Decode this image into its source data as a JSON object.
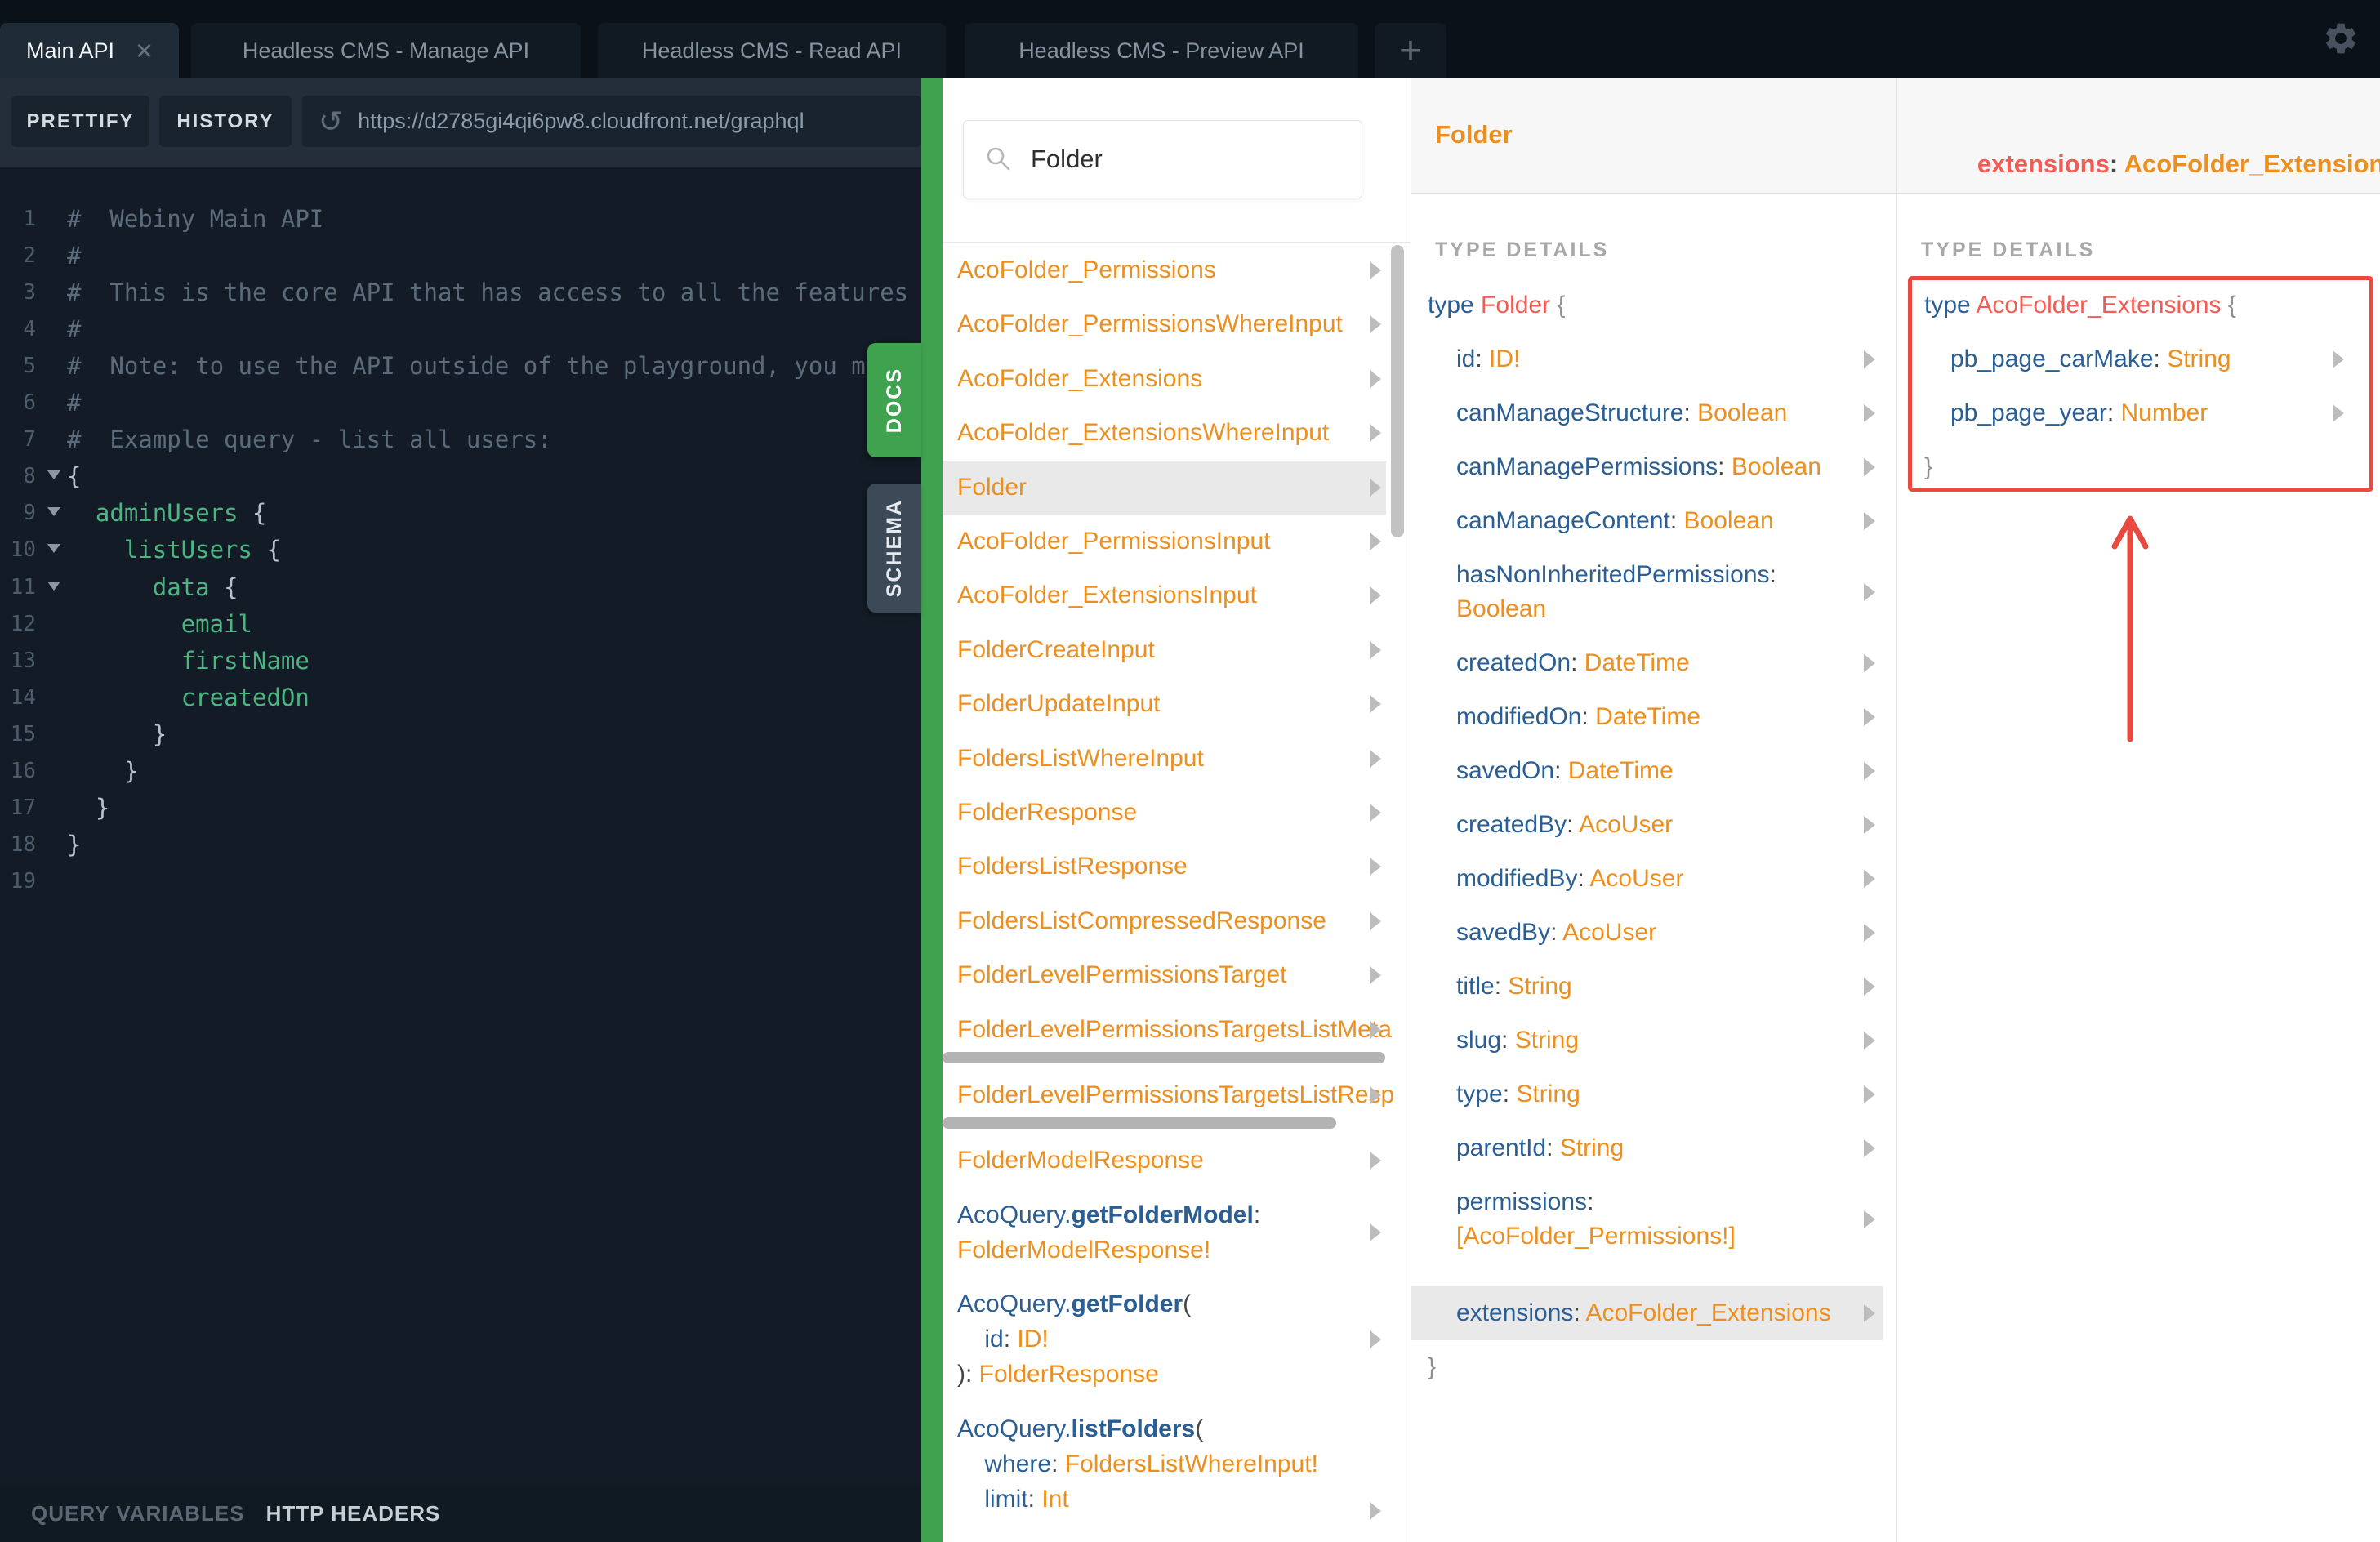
{
  "topbar": {
    "tabs": [
      {
        "label": "Main API",
        "active": true,
        "closable": true
      },
      {
        "label": "Headless CMS - Manage API",
        "active": false
      },
      {
        "label": "Headless CMS - Read API",
        "active": false
      },
      {
        "label": "Headless CMS - Preview API",
        "active": false
      }
    ],
    "plus_label": "+",
    "close_label": "×"
  },
  "toolbar": {
    "prettify_label": "PRETTIFY",
    "history_label": "HISTORY",
    "url": "https://d2785gi4qi6pw8.cloudfront.net/graphql",
    "reload_icon": "↺"
  },
  "side_tabs": {
    "docs": "DOCS",
    "schema": "SCHEMA"
  },
  "bottom": {
    "query_variables": "QUERY VARIABLES",
    "http_headers": "HTTP HEADERS"
  },
  "editor": {
    "lines": [
      {
        "n": 1,
        "tokens": [
          [
            "cm",
            "#  Webiny Main API"
          ]
        ]
      },
      {
        "n": 2,
        "tokens": [
          [
            "cm",
            "#"
          ]
        ]
      },
      {
        "n": 3,
        "tokens": [
          [
            "cm",
            "#  This is the core API that has access to all the features"
          ]
        ]
      },
      {
        "n": 4,
        "tokens": [
          [
            "cm",
            "#"
          ]
        ]
      },
      {
        "n": 5,
        "tokens": [
          [
            "cm",
            "#  Note: to use the API outside of the playground, you must"
          ]
        ]
      },
      {
        "n": 6,
        "tokens": [
          [
            "cm",
            "#"
          ]
        ]
      },
      {
        "n": 7,
        "tokens": [
          [
            "cm",
            "#  Example query - list all users:"
          ]
        ]
      },
      {
        "n": 8,
        "fold": true,
        "tokens": [
          [
            "br",
            "{"
          ]
        ]
      },
      {
        "n": 9,
        "fold": true,
        "tokens": [
          [
            "sp",
            "  "
          ],
          [
            "fld",
            "adminUsers"
          ],
          [
            "br",
            " {"
          ]
        ]
      },
      {
        "n": 10,
        "fold": true,
        "tokens": [
          [
            "sp",
            "    "
          ],
          [
            "fld",
            "listUsers"
          ],
          [
            "br",
            " {"
          ]
        ]
      },
      {
        "n": 11,
        "fold": true,
        "tokens": [
          [
            "sp",
            "      "
          ],
          [
            "fld",
            "data"
          ],
          [
            "br",
            " {"
          ]
        ]
      },
      {
        "n": 12,
        "tokens": [
          [
            "sp",
            "        "
          ],
          [
            "fld",
            "email"
          ]
        ]
      },
      {
        "n": 13,
        "tokens": [
          [
            "sp",
            "        "
          ],
          [
            "fld",
            "firstName"
          ]
        ]
      },
      {
        "n": 14,
        "tokens": [
          [
            "sp",
            "        "
          ],
          [
            "fld",
            "createdOn"
          ]
        ]
      },
      {
        "n": 15,
        "tokens": [
          [
            "sp",
            "      "
          ],
          [
            "br",
            "}"
          ]
        ]
      },
      {
        "n": 16,
        "tokens": [
          [
            "sp",
            "    "
          ],
          [
            "br",
            "}"
          ]
        ]
      },
      {
        "n": 17,
        "tokens": [
          [
            "sp",
            "  "
          ],
          [
            "br",
            "}"
          ]
        ]
      },
      {
        "n": 18,
        "tokens": [
          [
            "br",
            "}"
          ]
        ]
      },
      {
        "n": 19,
        "tokens": []
      }
    ]
  },
  "explorer": {
    "search_value": "Folder",
    "items": [
      {
        "lines": [
          [
            [
              "o",
              "AcoFolder_Permissions"
            ]
          ]
        ],
        "arrow": true
      },
      {
        "lines": [
          [
            [
              "o",
              "AcoFolder_PermissionsWhereInput"
            ]
          ]
        ],
        "arrow": true
      },
      {
        "lines": [
          [
            [
              "o",
              "AcoFolder_Extensions"
            ]
          ]
        ],
        "arrow": true
      },
      {
        "lines": [
          [
            [
              "o",
              "AcoFolder_ExtensionsWhereInput"
            ]
          ]
        ],
        "arrow": true
      },
      {
        "lines": [
          [
            [
              "o",
              "Folder"
            ]
          ]
        ],
        "arrow": true,
        "highlight": true
      },
      {
        "lines": [
          [
            [
              "o",
              "AcoFolder_PermissionsInput"
            ]
          ]
        ],
        "arrow": true
      },
      {
        "lines": [
          [
            [
              "o",
              "AcoFolder_ExtensionsInput"
            ]
          ]
        ],
        "arrow": true
      },
      {
        "lines": [
          [
            [
              "o",
              "FolderCreateInput"
            ]
          ]
        ],
        "arrow": true
      },
      {
        "lines": [
          [
            [
              "o",
              "FolderUpdateInput"
            ]
          ]
        ],
        "arrow": true
      },
      {
        "lines": [
          [
            [
              "o",
              "FoldersListWhereInput"
            ]
          ]
        ],
        "arrow": true
      },
      {
        "lines": [
          [
            [
              "o",
              "FolderResponse"
            ]
          ]
        ],
        "arrow": true
      },
      {
        "lines": [
          [
            [
              "o",
              "FoldersListResponse"
            ]
          ]
        ],
        "arrow": true
      },
      {
        "lines": [
          [
            [
              "o",
              "FoldersListCompressedResponse"
            ]
          ]
        ],
        "arrow": true
      },
      {
        "lines": [
          [
            [
              "o",
              "FolderLevelPermissionsTarget"
            ]
          ]
        ],
        "arrow": true
      },
      {
        "lines": [
          [
            [
              "o",
              "FolderLevelPermissionsTargetsListMeta"
            ]
          ]
        ],
        "arrow": true,
        "hscroll": 542
      },
      {
        "lines": [
          [
            [
              "o",
              "FolderLevelPermissionsTargetsListRespo"
            ]
          ]
        ],
        "arrow": true,
        "hscroll": 482
      },
      {
        "lines": [
          [
            [
              "o",
              "FolderModelResponse"
            ]
          ]
        ],
        "arrow": true
      },
      {
        "lines": [
          [
            [
              "b",
              "AcoQuery."
            ],
            [
              "bb",
              "getFolderModel"
            ],
            [
              "d",
              ":"
            ]
          ],
          [
            [
              "o",
              "FolderModelResponse!"
            ]
          ]
        ],
        "arrow": true
      },
      {
        "lines": [
          [
            [
              "b",
              "AcoQuery."
            ],
            [
              "bb",
              "getFolder"
            ],
            [
              "d",
              "("
            ]
          ],
          [
            [
              "sp",
              "    "
            ],
            [
              "b",
              "id"
            ],
            [
              "d",
              ": "
            ],
            [
              "o",
              "ID!"
            ]
          ],
          [
            [
              "d",
              "): "
            ],
            [
              "o",
              "FolderResponse"
            ]
          ]
        ],
        "arrow": true
      },
      {
        "lines": [
          [
            [
              "b",
              "AcoQuery."
            ],
            [
              "bb",
              "listFolders"
            ],
            [
              "d",
              "("
            ]
          ],
          [
            [
              "sp",
              "    "
            ],
            [
              "b",
              "where"
            ],
            [
              "d",
              ": "
            ],
            [
              "o",
              "FoldersListWhereInput!"
            ]
          ],
          [
            [
              "sp",
              "    "
            ],
            [
              "b",
              "limit"
            ],
            [
              "d",
              ": "
            ],
            [
              "o",
              "Int"
            ]
          ]
        ],
        "arrow": true,
        "arrow_at_end": true
      }
    ]
  },
  "folder_panel": {
    "header": "Folder",
    "section_label": "TYPE DETAILS",
    "decl": {
      "keyword": "type",
      "name": "Folder",
      "open_brace": "{",
      "close_brace": "}"
    },
    "fields": [
      {
        "name": "id",
        "type": "ID!"
      },
      {
        "name": "canManageStructure",
        "type": "Boolean"
      },
      {
        "name": "canManagePermissions",
        "type": "Boolean"
      },
      {
        "name": "canManageContent",
        "type": "Boolean"
      },
      {
        "name": "hasNonInheritedPermissions",
        "type": "Boolean",
        "wrap": true
      },
      {
        "name": "createdOn",
        "type": "DateTime"
      },
      {
        "name": "modifiedOn",
        "type": "DateTime"
      },
      {
        "name": "savedOn",
        "type": "DateTime"
      },
      {
        "name": "createdBy",
        "type": "AcoUser"
      },
      {
        "name": "modifiedBy",
        "type": "AcoUser"
      },
      {
        "name": "savedBy",
        "type": "AcoUser"
      },
      {
        "name": "title",
        "type": "String"
      },
      {
        "name": "slug",
        "type": "String"
      },
      {
        "name": "type",
        "type": "String"
      },
      {
        "name": "parentId",
        "type": "String"
      },
      {
        "name": "permissions",
        "type": "[AcoFolder_Permissions!]",
        "wrap": true
      },
      {
        "name": "extensions",
        "type": "AcoFolder_Extensions",
        "highlight": true
      }
    ]
  },
  "extensions_panel": {
    "header": {
      "field": "extensions",
      "colon": ":",
      "type": " AcoFolder_Extensions"
    },
    "section_label": "TYPE DETAILS",
    "decl": {
      "keyword": "type",
      "name": "AcoFolder_Extensions",
      "open_brace": "{",
      "close_brace": "}"
    },
    "fields": [
      {
        "name": "pb_page_carMake",
        "type": "String"
      },
      {
        "name": "pb_page_year",
        "type": "Number"
      }
    ]
  },
  "colors": {
    "topbar_bg": "#0a1118",
    "tab_bg": "#111a23",
    "tab_text": "#8593a0",
    "tab_active_bg": "#1f2b37",
    "tab_active_text": "#f3f6f8",
    "toolbar_bg": "#232e3a",
    "button_bg": "#19232e",
    "button_text": "#d4dbe1",
    "url_text": "#8c9caa",
    "editor_bg": "#131c26",
    "gutter": "#4d5c6a",
    "comment": "#5c6b7a",
    "field_green": "#4cb582",
    "bracket": "#b9c2ca",
    "fold": "#8b98a4",
    "bottombar_bg": "#101a23",
    "muted_label": "#5b6772",
    "bright_label": "#c6cfd6",
    "green": "#3fa24e",
    "schema_bg": "#3c4a58",
    "orange": "#ed8f1f",
    "blue": "#2a5f96",
    "red_syntax": "#f25c54",
    "annotation_red": "#e84a3f",
    "panel_border": "#e2e2e2",
    "header_bg": "#f7f7f7",
    "type_details": "#a8a8a8",
    "dark_punct": "#454545",
    "gray_brace": "#8f8f8f",
    "arrow": "#bcbcbc",
    "highlight": "#e9e9e9",
    "scrollbar": "#c2c2c2",
    "hscrollbar": "#b3b3b3",
    "search_border": "#e3e3e3",
    "search_text": "#2f2f2f",
    "icon_gray": "#b6b6b6",
    "gear": "#47525e",
    "plus": "#5a6671",
    "close_x": "#66737e"
  }
}
